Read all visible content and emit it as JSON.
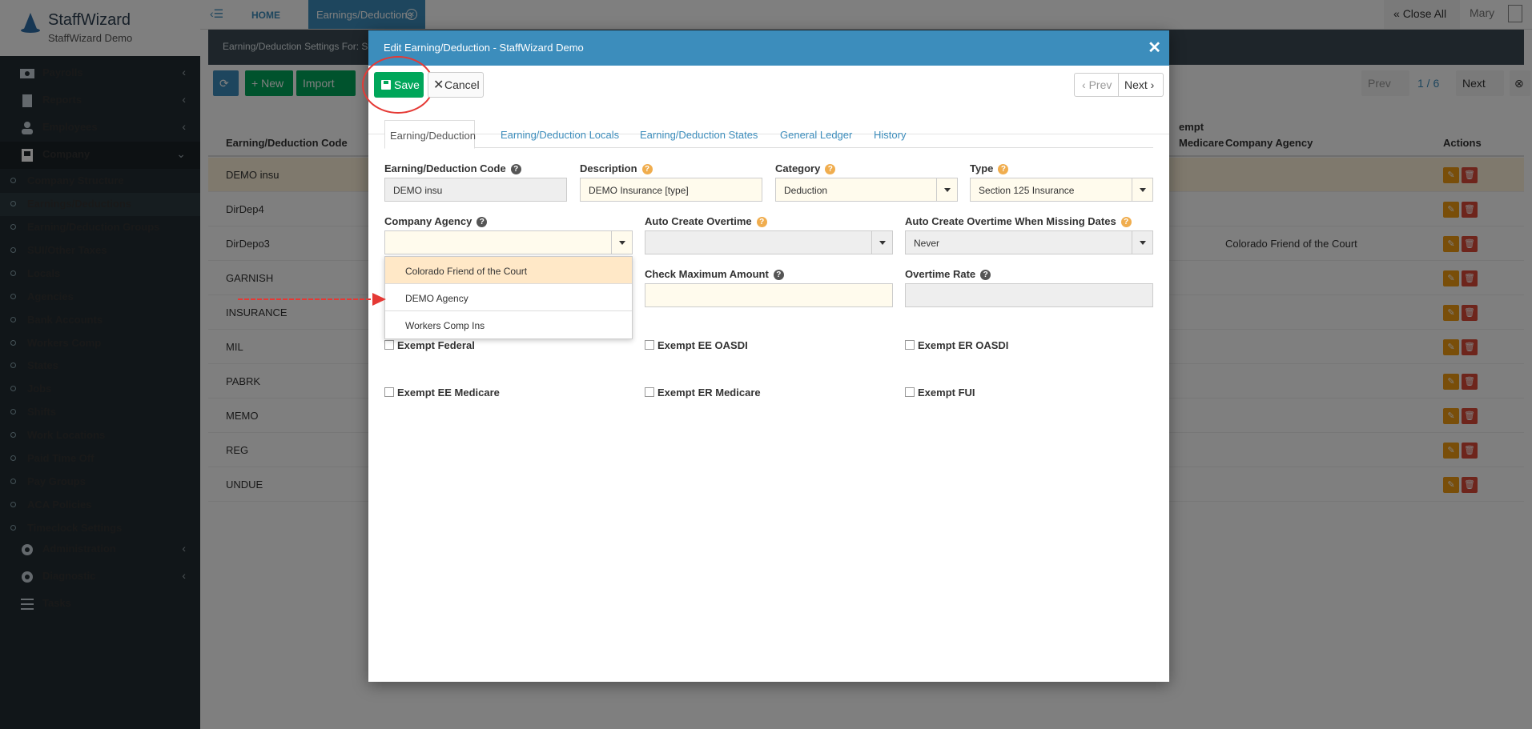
{
  "brand": {
    "name": "StaffWizard",
    "sub": "StaffWizard Demo"
  },
  "topbar": {
    "home": "HOME",
    "open_tab": "Earnings/Deductions",
    "close_all": "Close All",
    "user": "Mary"
  },
  "sidebar": {
    "main": [
      {
        "label": "Payrolls"
      },
      {
        "label": "Reports"
      },
      {
        "label": "Employees"
      },
      {
        "label": "Company"
      }
    ],
    "company_items": [
      {
        "label": "Company Structure"
      },
      {
        "label": "Earnings/Deductions"
      },
      {
        "label": "Earning/Deduction Groups"
      },
      {
        "label": "SUI/Other Taxes"
      },
      {
        "label": "Locals"
      },
      {
        "label": "Agencies"
      },
      {
        "label": "Bank Accounts"
      },
      {
        "label": "Workers Comp"
      },
      {
        "label": "States"
      },
      {
        "label": "Jobs"
      },
      {
        "label": "Shifts"
      },
      {
        "label": "Work Locations"
      },
      {
        "label": "Paid Time Off"
      },
      {
        "label": "Pay Groups"
      },
      {
        "label": "ACA Policies"
      },
      {
        "label": "Timeclock Settings"
      }
    ],
    "bottom": [
      {
        "label": "Administration"
      },
      {
        "label": "Diagnostic"
      },
      {
        "label": "Tasks"
      }
    ]
  },
  "background": {
    "header": "Earning/Deduction Settings For: St",
    "new_button": "New",
    "import_button": "Import",
    "pager": {
      "prev": "Prev",
      "page": "1 / 6",
      "next": "Next"
    },
    "columns": {
      "code": "Earning/Deduction Code",
      "exempt_top": "empt",
      "exempt_bottom": "Medicare",
      "agency": "Company Agency",
      "actions": "Actions"
    },
    "rows": [
      {
        "code": "DEMO insu",
        "agency": ""
      },
      {
        "code": "DirDep4",
        "agency": ""
      },
      {
        "code": "DirDepo3",
        "agency": "Colorado Friend of the Court"
      },
      {
        "code": "GARNISH",
        "agency": ""
      },
      {
        "code": "INSURANCE",
        "agency": ""
      },
      {
        "code": "MIL",
        "agency": ""
      },
      {
        "code": "PABRK",
        "agency": ""
      },
      {
        "code": "MEMO",
        "agency": ""
      },
      {
        "code": "REG",
        "agency": ""
      },
      {
        "code": "UNDUE",
        "agency": ""
      }
    ]
  },
  "modal": {
    "title": "Edit Earning/Deduction - StaffWizard Demo",
    "save": "Save",
    "cancel": "Cancel",
    "prev": "Prev",
    "next": "Next",
    "tabs": [
      "Earning/Deduction",
      "Earning/Deduction Locals",
      "Earning/Deduction States",
      "General Ledger",
      "History"
    ],
    "fields": {
      "code": {
        "label": "Earning/Deduction Code",
        "value": "DEMO insu"
      },
      "description": {
        "label": "Description",
        "value": "DEMO Insurance [type]"
      },
      "category": {
        "label": "Category",
        "value": "Deduction"
      },
      "type": {
        "label": "Type",
        "value": "Section 125 Insurance"
      },
      "agency": {
        "label": "Company Agency",
        "value": ""
      },
      "auto_ot": {
        "label": "Auto Create Overtime",
        "value": ""
      },
      "auto_ot_missing": {
        "label": "Auto Create Overtime When Missing Dates",
        "value": "Never"
      },
      "check_max": {
        "label": "Check Maximum Amount",
        "value": ""
      },
      "ot_rate": {
        "label": "Overtime Rate",
        "value": ""
      }
    },
    "agency_options": [
      "Colorado Friend of the Court",
      "DEMO Agency",
      "Workers Comp Ins"
    ],
    "checkboxes": [
      "Exempt Federal",
      "Exempt EE OASDI",
      "Exempt ER OASDI",
      "Exempt EE Medicare",
      "Exempt ER Medicare",
      "Exempt FUI"
    ]
  },
  "colors": {
    "primary": "#3c8dbc",
    "save": "#00a65a",
    "sidebar": "#222d32",
    "annotation": "#e53935"
  }
}
